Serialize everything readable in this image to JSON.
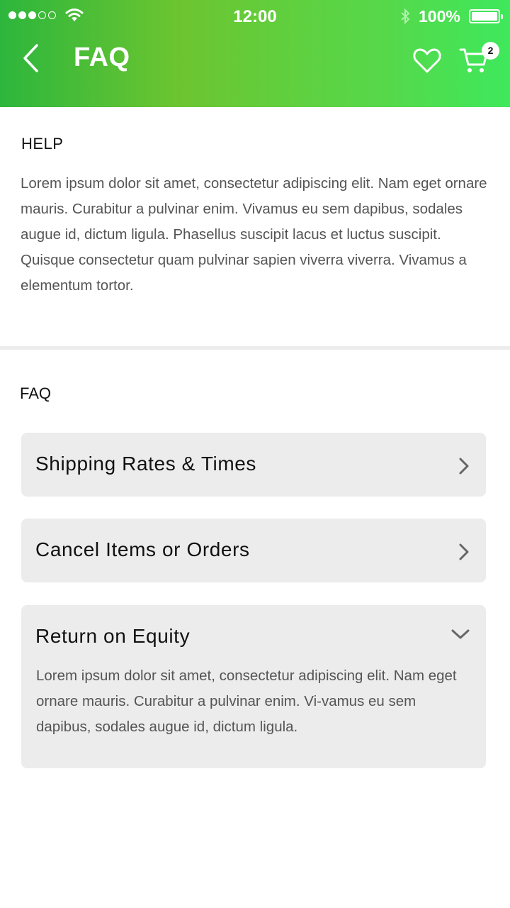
{
  "status_bar": {
    "time": "12:00",
    "battery": "100%",
    "signal_bars_filled": 3,
    "signal_bars_total": 5
  },
  "header": {
    "title": "FAQ",
    "cart_count": "2",
    "back_icon": "chevron-left-icon",
    "favorite_icon": "heart-icon",
    "cart_icon": "cart-icon",
    "gradient_colors": [
      "#2db63d",
      "#6cc530",
      "#3fe85c"
    ]
  },
  "help": {
    "heading": "HELP",
    "body": "Lorem ipsum dolor sit amet, consectetur adipiscing elit. Nam eget ornare mauris. Curabitur a pulvinar enim. Vivamus eu sem dapibus, sodales augue id, dictum ligula. Phasellus suscipit lacus et luctus suscipit. Quisque consectetur quam pulvinar sapien viverra viverra. Vivamus a elementum tortor."
  },
  "faq": {
    "heading": "FAQ",
    "items": [
      {
        "question": "Shipping Rates & Times",
        "expanded": false,
        "icon": "chevron-right-icon"
      },
      {
        "question": "Cancel Items or Orders",
        "expanded": false,
        "icon": "chevron-right-icon"
      },
      {
        "question": "Return on Equity",
        "expanded": true,
        "icon": "chevron-down-icon",
        "answer": "Lorem ipsum dolor sit amet, consectetur adipiscing elit. Nam eget ornare mauris. Curabitur a pulvinar enim. Vi-vamus eu sem dapibus, sodales augue id, dictum ligula."
      }
    ]
  }
}
